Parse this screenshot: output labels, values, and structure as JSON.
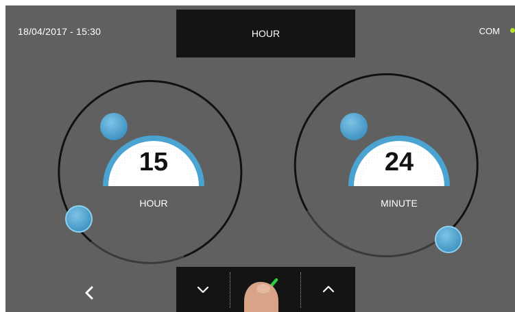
{
  "header": {
    "datetime": "18/04/2017 - 15:30",
    "title": "HOUR",
    "status_label": "COM",
    "status_color": "#b5e32d"
  },
  "dials": [
    {
      "label": "HOUR",
      "value": "15"
    },
    {
      "label": "MINUTE",
      "value": "24"
    }
  ],
  "controls": {
    "back_icon": "chevron-left-icon",
    "down_icon": "chevron-down-icon",
    "confirm_icon": "checkmark-icon",
    "up_icon": "chevron-up-icon",
    "confirm_color": "#2ecc40"
  },
  "colors": {
    "accent": "#4aa3d0",
    "screen_bg": "#606060",
    "bar_bg": "#141414"
  }
}
